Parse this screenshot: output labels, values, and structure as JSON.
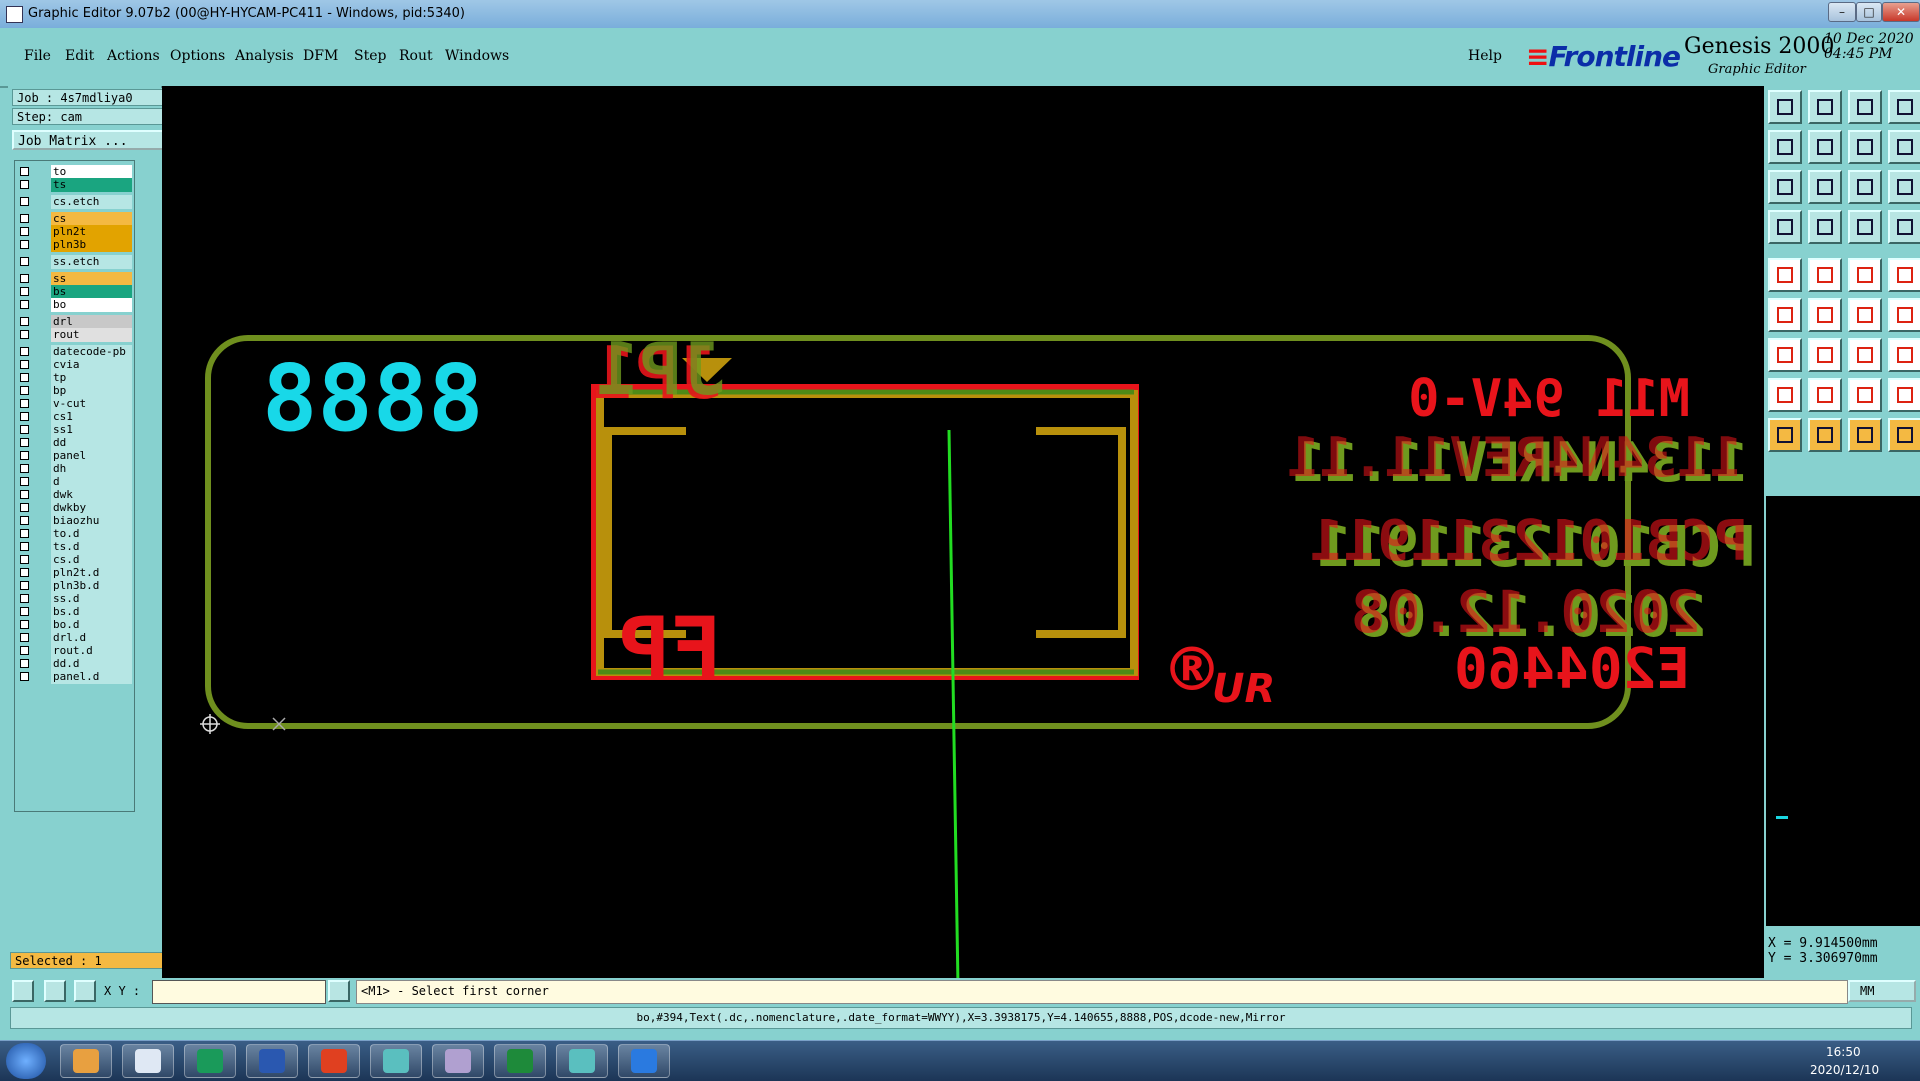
{
  "window": {
    "title": "Graphic Editor 9.07b2 (00@HY-HYCAM-PC411 - Windows, pid:5340)"
  },
  "menu": {
    "items": [
      "File",
      "Edit",
      "Actions",
      "Options",
      "Analysis",
      "DFM",
      "Step",
      "Rout",
      "Windows"
    ],
    "help": "Help"
  },
  "brand": {
    "logo": "Frontline",
    "product": "Genesis 2000",
    "subtitle": "Graphic Editor",
    "date": "10 Dec 2020",
    "time": "04:45 PM"
  },
  "job": {
    "job_label": "Job : 4s7mdliya0",
    "step_label": "Step: cam",
    "matrix_button": "Job Matrix ..."
  },
  "layers": [
    {
      "name": "to",
      "color": "#ffffff"
    },
    {
      "name": "ts",
      "color": "#1aa580"
    },
    {
      "name": "cs.etch",
      "color": "#b6e6e4"
    },
    {
      "name": "cs",
      "color": "#f4b942"
    },
    {
      "name": "pln2t",
      "color": "#e2a300"
    },
    {
      "name": "pln3b",
      "color": "#e2a300"
    },
    {
      "name": "ss.etch",
      "color": "#b6e6e4"
    },
    {
      "name": "ss",
      "color": "#f4b942"
    },
    {
      "name": "bs",
      "color": "#1aa580"
    },
    {
      "name": "bo",
      "color": "#ffffff"
    },
    {
      "name": "drl",
      "color": "#c8c8c8"
    },
    {
      "name": "rout",
      "color": "#e0e0e0"
    },
    {
      "name": "datecode-pb",
      "color": "#b6e6e4"
    },
    {
      "name": "cvia",
      "color": "#b6e6e4"
    },
    {
      "name": "tp",
      "color": "#b6e6e4"
    },
    {
      "name": "bp",
      "color": "#b6e6e4"
    },
    {
      "name": "v-cut",
      "color": "#b6e6e4"
    },
    {
      "name": "cs1",
      "color": "#b6e6e4"
    },
    {
      "name": "ss1",
      "color": "#b6e6e4"
    },
    {
      "name": "dd",
      "color": "#b6e6e4"
    },
    {
      "name": "panel",
      "color": "#b6e6e4"
    },
    {
      "name": "dh",
      "color": "#b6e6e4"
    },
    {
      "name": "d",
      "color": "#b6e6e4"
    },
    {
      "name": "dwk",
      "color": "#b6e6e4"
    },
    {
      "name": "dwkby",
      "color": "#b6e6e4"
    },
    {
      "name": "biaozhu",
      "color": "#b6e6e4"
    },
    {
      "name": "to.d",
      "color": "#b6e6e4"
    },
    {
      "name": "ts.d",
      "color": "#b6e6e4"
    },
    {
      "name": "cs.d",
      "color": "#b6e6e4"
    },
    {
      "name": "pln2t.d",
      "color": "#b6e6e4"
    },
    {
      "name": "pln3b.d",
      "color": "#b6e6e4"
    },
    {
      "name": "ss.d",
      "color": "#b6e6e4"
    },
    {
      "name": "bs.d",
      "color": "#b6e6e4"
    },
    {
      "name": "bo.d",
      "color": "#b6e6e4"
    },
    {
      "name": "drl.d",
      "color": "#b6e6e4"
    },
    {
      "name": "rout.d",
      "color": "#b6e6e4"
    },
    {
      "name": "dd.d",
      "color": "#b6e6e4"
    },
    {
      "name": "panel.d",
      "color": "#b6e6e4"
    }
  ],
  "selected": "Selected : 1",
  "canvas_text": {
    "digits": "8888",
    "jp": "JP1",
    "fp": "FP",
    "m11": "M11 94V-0",
    "rev": "1134N4REV11.11",
    "pcb": "PCB1012311911",
    "date": "2020.12.08",
    "reg": "®",
    "ul": "UR",
    "e204": "E204460"
  },
  "coordinates": {
    "x": "X = 9.914500mm",
    "y": "Y = 3.306970mm"
  },
  "command": {
    "xy_label": "X Y :",
    "xy_value": "",
    "prompt": "<M1> - Select first corner",
    "units": "MM"
  },
  "status_line": "bo,#394,Text(.dc,.nomenclature,.date_format=WWYY),X=3.3938175,Y=4.140655,8888,POS,dcode-new,Mirror",
  "taskbar": {
    "time": "16:50",
    "date": "2020/12/10"
  }
}
